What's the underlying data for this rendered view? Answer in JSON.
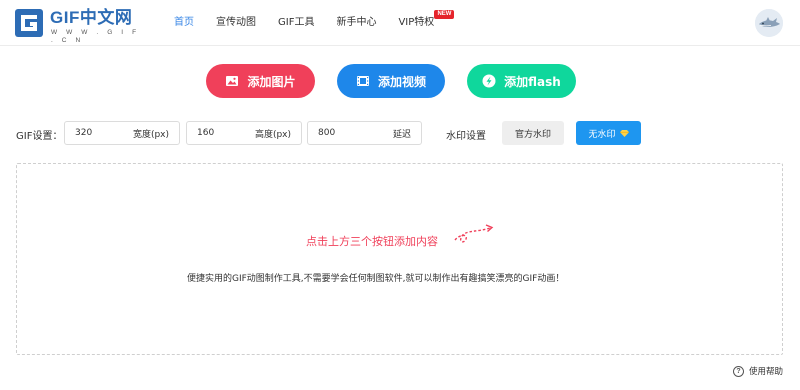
{
  "logo": {
    "title": "GIF中文网",
    "subtitle": "W W W . G I F . C N",
    "icon": "gif-logo-icon"
  },
  "nav": {
    "items": [
      {
        "label": "首页",
        "active": true
      },
      {
        "label": "宣传动图"
      },
      {
        "label": "GIF工具"
      },
      {
        "label": "新手中心"
      },
      {
        "label": "VIP特权",
        "badge": "NEW"
      }
    ]
  },
  "user": {
    "avatar_icon": "shark-avatar-icon"
  },
  "actions": {
    "add_image": "添加图片",
    "add_video": "添加视频",
    "add_flash": "添加flash",
    "colors": {
      "image": "#f0405a",
      "video": "#1e87ea",
      "flash": "#0fd79c"
    }
  },
  "settings": {
    "label": "GIF设置：",
    "width_value": "320",
    "width_unit": "宽度(px)",
    "height_value": "160",
    "height_unit": "高度(px)",
    "delay_value": "800",
    "delay_unit": "延迟",
    "watermark_label": "水印设置",
    "watermark_official": "官方水印",
    "watermark_none": "无水印"
  },
  "dropzone": {
    "hint": "点击上方三个按钮添加内容",
    "description": "便捷实用的GIF动图制作工具,不需要学会任何制图软件,就可以制作出有趣搞笑漂亮的GIF动画！"
  },
  "footer": {
    "help": "使用帮助"
  }
}
